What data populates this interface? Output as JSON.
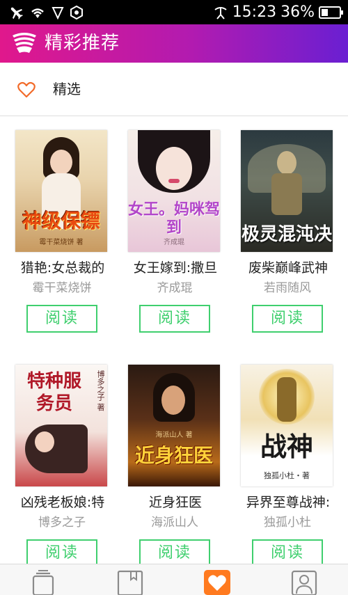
{
  "status_bar": {
    "time": "15:23",
    "battery_percent": "36%",
    "battery_level": 0.36
  },
  "app_bar": {
    "title": "精彩推荐"
  },
  "section": {
    "title": "精选",
    "icon": "heart-outline-icon"
  },
  "colors": {
    "accent_start": "#e0188c",
    "accent_end": "#6a1fd2",
    "read_button": "#3fcf6e",
    "active_tab": "#ff7a1f",
    "heart_outline": "#f26b2a"
  },
  "books": [
    {
      "title": "猎艳:女总裁的",
      "author": "霉干菜烧饼",
      "action": "阅读",
      "cover_text": "神级保镖",
      "cover_sub": "霉干菜烧饼 著"
    },
    {
      "title": "女王嫁到:撒旦",
      "author": "齐成琨",
      "action": "阅读",
      "cover_text": "女王。妈咪驾到",
      "cover_sub": "齐成琨"
    },
    {
      "title": "废柴巅峰武神",
      "author": "若雨随风",
      "action": "阅读",
      "cover_text": "极灵混沌决",
      "cover_sub": "若雨随风"
    },
    {
      "title": "凶残老板娘:特",
      "author": "博多之子",
      "action": "阅读",
      "cover_text": "特种服务员",
      "cover_sub": "博多之子 著"
    },
    {
      "title": "近身狂医",
      "author": "海派山人",
      "action": "阅读",
      "cover_text": "近身狂医",
      "cover_sub": "海派山人 著"
    },
    {
      "title": "异界至尊战神:",
      "author": "独孤小杜",
      "action": "阅读",
      "cover_text": "战神",
      "cover_sub": "独孤小杜・著"
    }
  ],
  "tab_bar": {
    "tabs": [
      {
        "name": "bookshelf",
        "icon": "bookshelf-icon",
        "active": false
      },
      {
        "name": "bookstore",
        "icon": "bookmark-book-icon",
        "active": false
      },
      {
        "name": "recommend",
        "icon": "heart-icon",
        "active": true
      },
      {
        "name": "profile",
        "icon": "person-icon",
        "active": false
      }
    ]
  }
}
